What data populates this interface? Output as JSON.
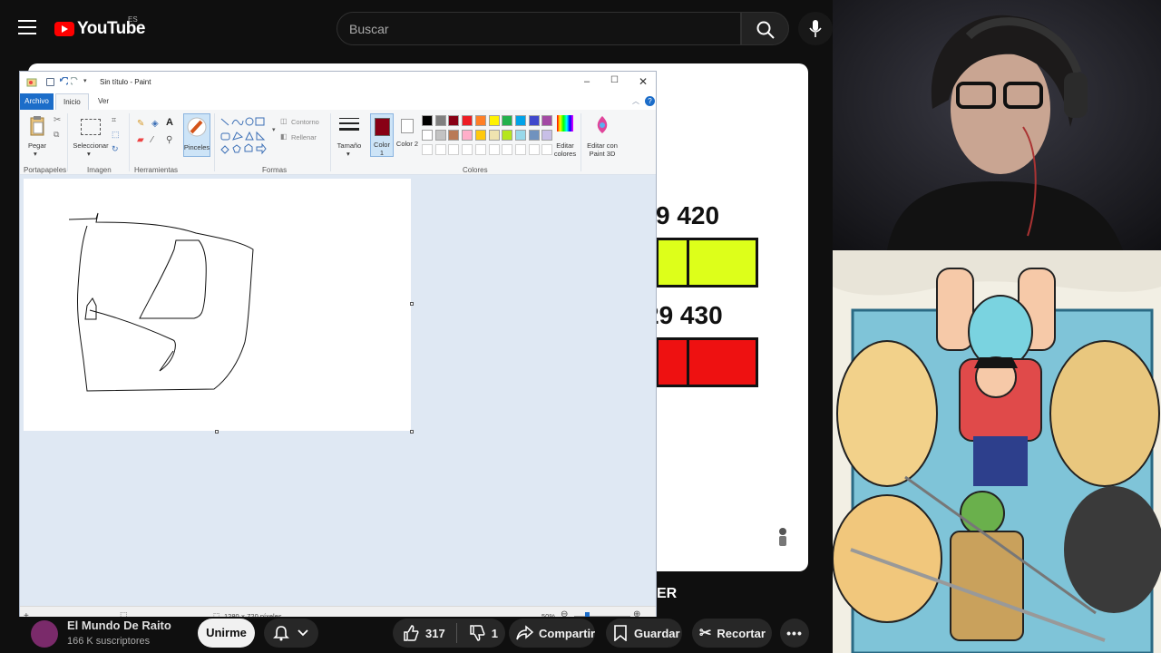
{
  "youtube": {
    "logo_text": "YouTube",
    "country": "ES",
    "search_placeholder": "Buscar"
  },
  "slide": {
    "row1_nums": "9   420",
    "row2_nums": "29   430",
    "row1_color": "#ddff1a",
    "row2_color": "#ee1111",
    "footer_text": "ER"
  },
  "paint": {
    "window_title": "Sin título - Paint",
    "tabs": [
      "Archivo",
      "Inicio",
      "Ver"
    ],
    "groups": {
      "portapapeles": "Portapapeles",
      "imagen": "Imagen",
      "herramientas": "Herramientas",
      "formas": "Formas",
      "colores": "Colores"
    },
    "buttons": {
      "pegar": "Pegar",
      "seleccionar": "Seleccionar",
      "pinceles": "Pinceles",
      "contorno": "Contorno",
      "rellenar": "Rellenar",
      "tamano": "Tamaño",
      "color1": "Color 1",
      "color2": "Color 2",
      "editar_colores": "Editar colores",
      "paint3d": "Editar con Paint 3D"
    },
    "palette_row1": [
      "#000000",
      "#7f7f7f",
      "#880015",
      "#ed1c24",
      "#ff7f27",
      "#fff200",
      "#22b14c",
      "#00a2e8",
      "#3f48cc",
      "#a349a4"
    ],
    "palette_row2": [
      "#ffffff",
      "#c3c3c3",
      "#b97a57",
      "#ffaec9",
      "#ffc90e",
      "#efe4b0",
      "#b5e61d",
      "#99d9ea",
      "#7092be",
      "#c8bfe7"
    ],
    "color1": "#880015",
    "status": {
      "dimensions": "1280 × 720 píxeles",
      "zoom": "50%"
    }
  },
  "bottom": {
    "channel_name": "El Mundo De Raito",
    "subscribers": "166 K suscriptores",
    "join": "Unirme",
    "likes": "317",
    "dislikes": "1",
    "share": "Compartir",
    "save": "Guardar",
    "clip": "Recortar"
  }
}
